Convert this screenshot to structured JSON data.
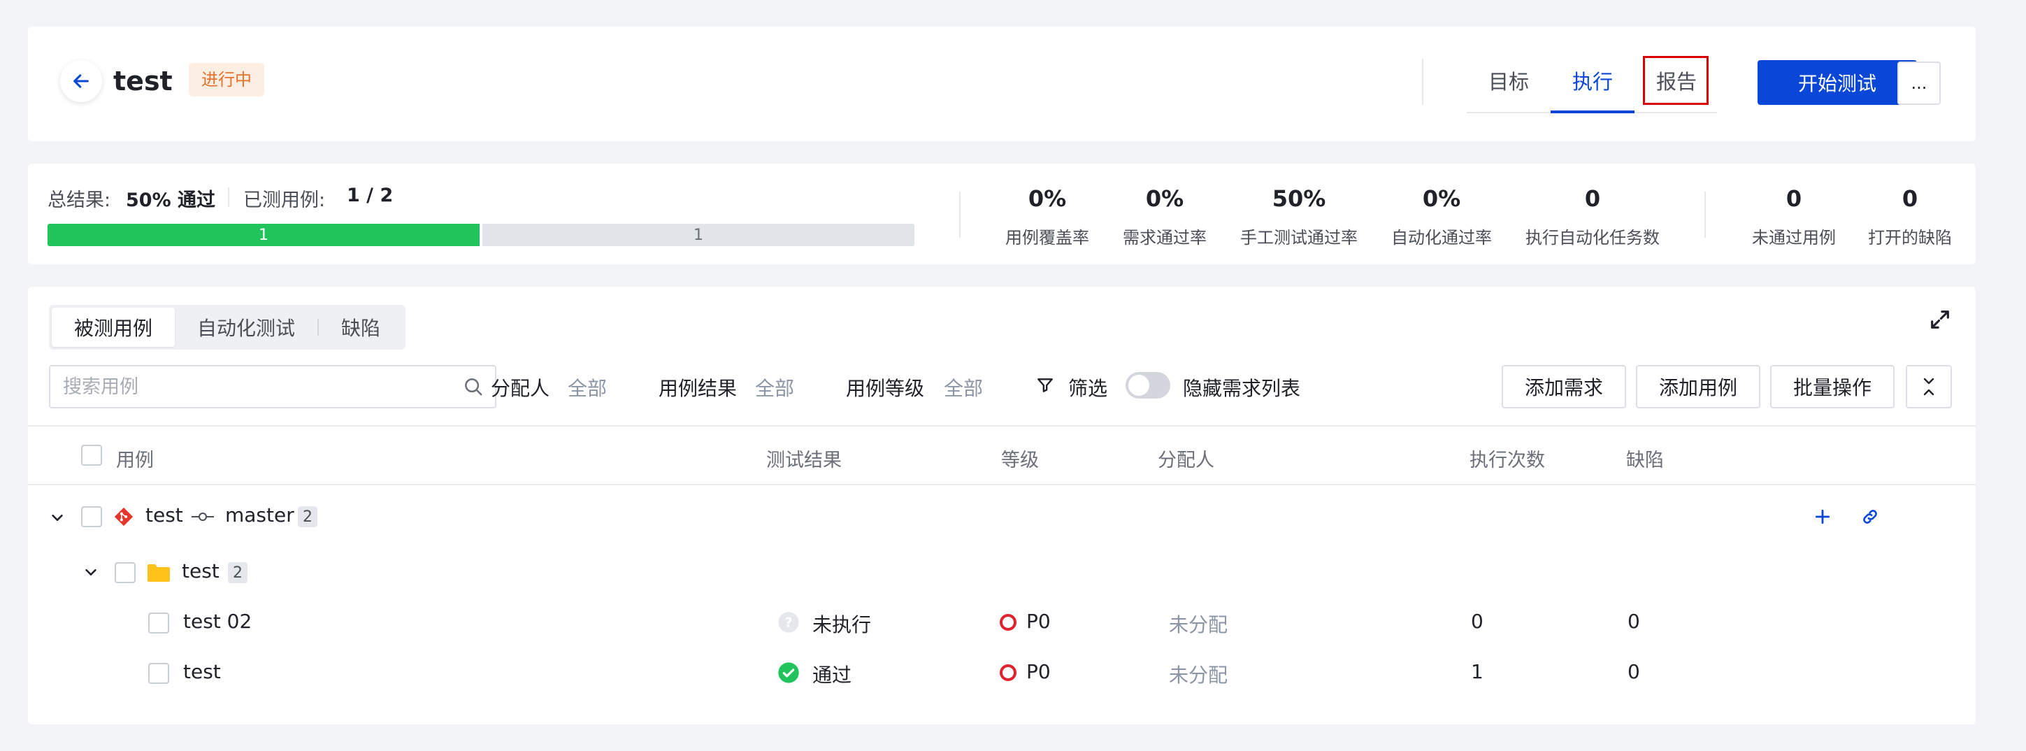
{
  "header": {
    "title": "test",
    "status": "进行中",
    "tabs": [
      "目标",
      "执行",
      "报告"
    ],
    "active_tab": "执行",
    "start_button": "开始测试",
    "more_button": "..."
  },
  "summary": {
    "overall_label": "总结果:",
    "overall_value": "50% 通过",
    "tested_label": "已测用例:",
    "tested_value": "1 / 2",
    "progress": {
      "passed": "1",
      "remaining": "1",
      "pass_fraction": 0.5
    },
    "metrics": [
      {
        "value": "0%",
        "label": "用例覆盖率"
      },
      {
        "value": "0%",
        "label": "需求通过率"
      },
      {
        "value": "50%",
        "label": "手工测试通过率"
      },
      {
        "value": "0%",
        "label": "自动化通过率"
      },
      {
        "value": "0",
        "label": "执行自动化任务数"
      },
      {
        "value": "0",
        "label": "未通过用例"
      },
      {
        "value": "0",
        "label": "打开的缺陷"
      }
    ]
  },
  "main": {
    "seg_tabs": [
      "被测用例",
      "自动化测试",
      "缺陷"
    ],
    "search_placeholder": "搜索用例",
    "filters": [
      {
        "label": "分配人",
        "value": "全部"
      },
      {
        "label": "用例结果",
        "value": "全部"
      },
      {
        "label": "用例等级",
        "value": "全部"
      }
    ],
    "filter_button": "筛选",
    "toggle_label": "隐藏需求列表",
    "buttons": [
      "添加需求",
      "添加用例",
      "批量操作"
    ],
    "columns": [
      "用例",
      "测试结果",
      "等级",
      "分配人",
      "执行次数",
      "缺陷"
    ],
    "repo": {
      "name": "test",
      "branch": "master",
      "count": "2"
    },
    "folder": {
      "name": "test",
      "count": "2"
    },
    "rows": [
      {
        "name": "test 02",
        "result": "未执行",
        "level": "P0",
        "assignee": "未分配",
        "runs": "0",
        "defects": "0"
      },
      {
        "name": "test",
        "result": "通过",
        "level": "P0",
        "assignee": "未分配",
        "runs": "1",
        "defects": "0"
      }
    ]
  }
}
